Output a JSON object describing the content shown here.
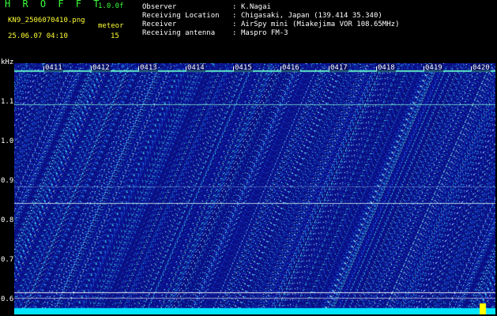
{
  "header": {
    "app_title": "H R O F F T",
    "version": "1.0.0f",
    "filename": "KN9_2506070410.png",
    "mode": "meteor",
    "datetime": "25.06.07 04:10",
    "count": "15",
    "info": [
      {
        "label": "Observer",
        "value": "K.Nagai"
      },
      {
        "label": "Receiving Location",
        "value": "Chigasaki, Japan (139.414 35.340)"
      },
      {
        "label": "Receiver",
        "value": "AirSpy mini (Miakejima VOR 108.65MHz)"
      },
      {
        "label": "Receiving antenna",
        "value": "Maspro FM-3"
      }
    ]
  },
  "spectrogram": {
    "y_unit": "kHz",
    "y_ticks": [
      "1.1",
      "1.0",
      "0.9",
      "0.8",
      "0.7",
      "0.6"
    ],
    "time_labels": [
      "0411",
      "0412",
      "0413",
      "0414",
      "0415",
      "0416",
      "0417",
      "0418",
      "0419",
      "0420"
    ]
  }
}
